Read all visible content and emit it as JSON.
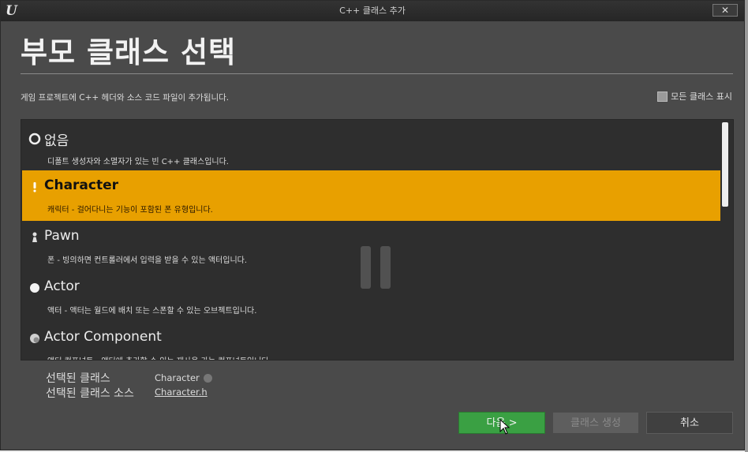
{
  "window": {
    "title": "C++ 클래스 추가",
    "logo_text": "U",
    "close_glyph": "✕"
  },
  "heading": "부모 클래스 선택",
  "subtitle": "게임 프로젝트에 C++ 헤더와 소스 코드 파일이 추가됩니다.",
  "show_all_label": "모든 클래스 표시",
  "classes": [
    {
      "name": "없음",
      "desc": "디폴트 생성자와 소멸자가 있는 빈 C++ 클래스입니다.",
      "icon": "empty-circle-icon",
      "selected": false
    },
    {
      "name": "Character",
      "desc": "캐릭터 - 걸어다니는 기능이 포함된 폰 유형입니다.",
      "icon": "character-icon",
      "selected": true
    },
    {
      "name": "Pawn",
      "desc": "폰 - 빙의하면 컨트롤러에서 입력을 받을 수 있는 액터입니다.",
      "icon": "pawn-icon",
      "selected": false
    },
    {
      "name": "Actor",
      "desc": "액터 - 액터는 월드에 배치 또는 스폰할 수 있는 오브젝트입니다.",
      "icon": "actor-sphere-icon",
      "selected": false
    },
    {
      "name": "Actor Component",
      "desc": "액터 컴포넌트 - 액터에 추가할 수 있는 재사용 가능 컴포넌트입니다.",
      "icon": "actor-component-icon",
      "selected": false
    }
  ],
  "selection": {
    "class_label": "선택된 클래스",
    "class_value": "Character",
    "source_label": "선택된 클래스 소스",
    "source_value": "Character.h"
  },
  "buttons": {
    "next": "다음 >",
    "create": "클래스 생성",
    "cancel": "취소"
  },
  "colors": {
    "selected_row": "#e8a000",
    "next_button": "#3aa043",
    "window_bg": "#4a4a4a"
  }
}
